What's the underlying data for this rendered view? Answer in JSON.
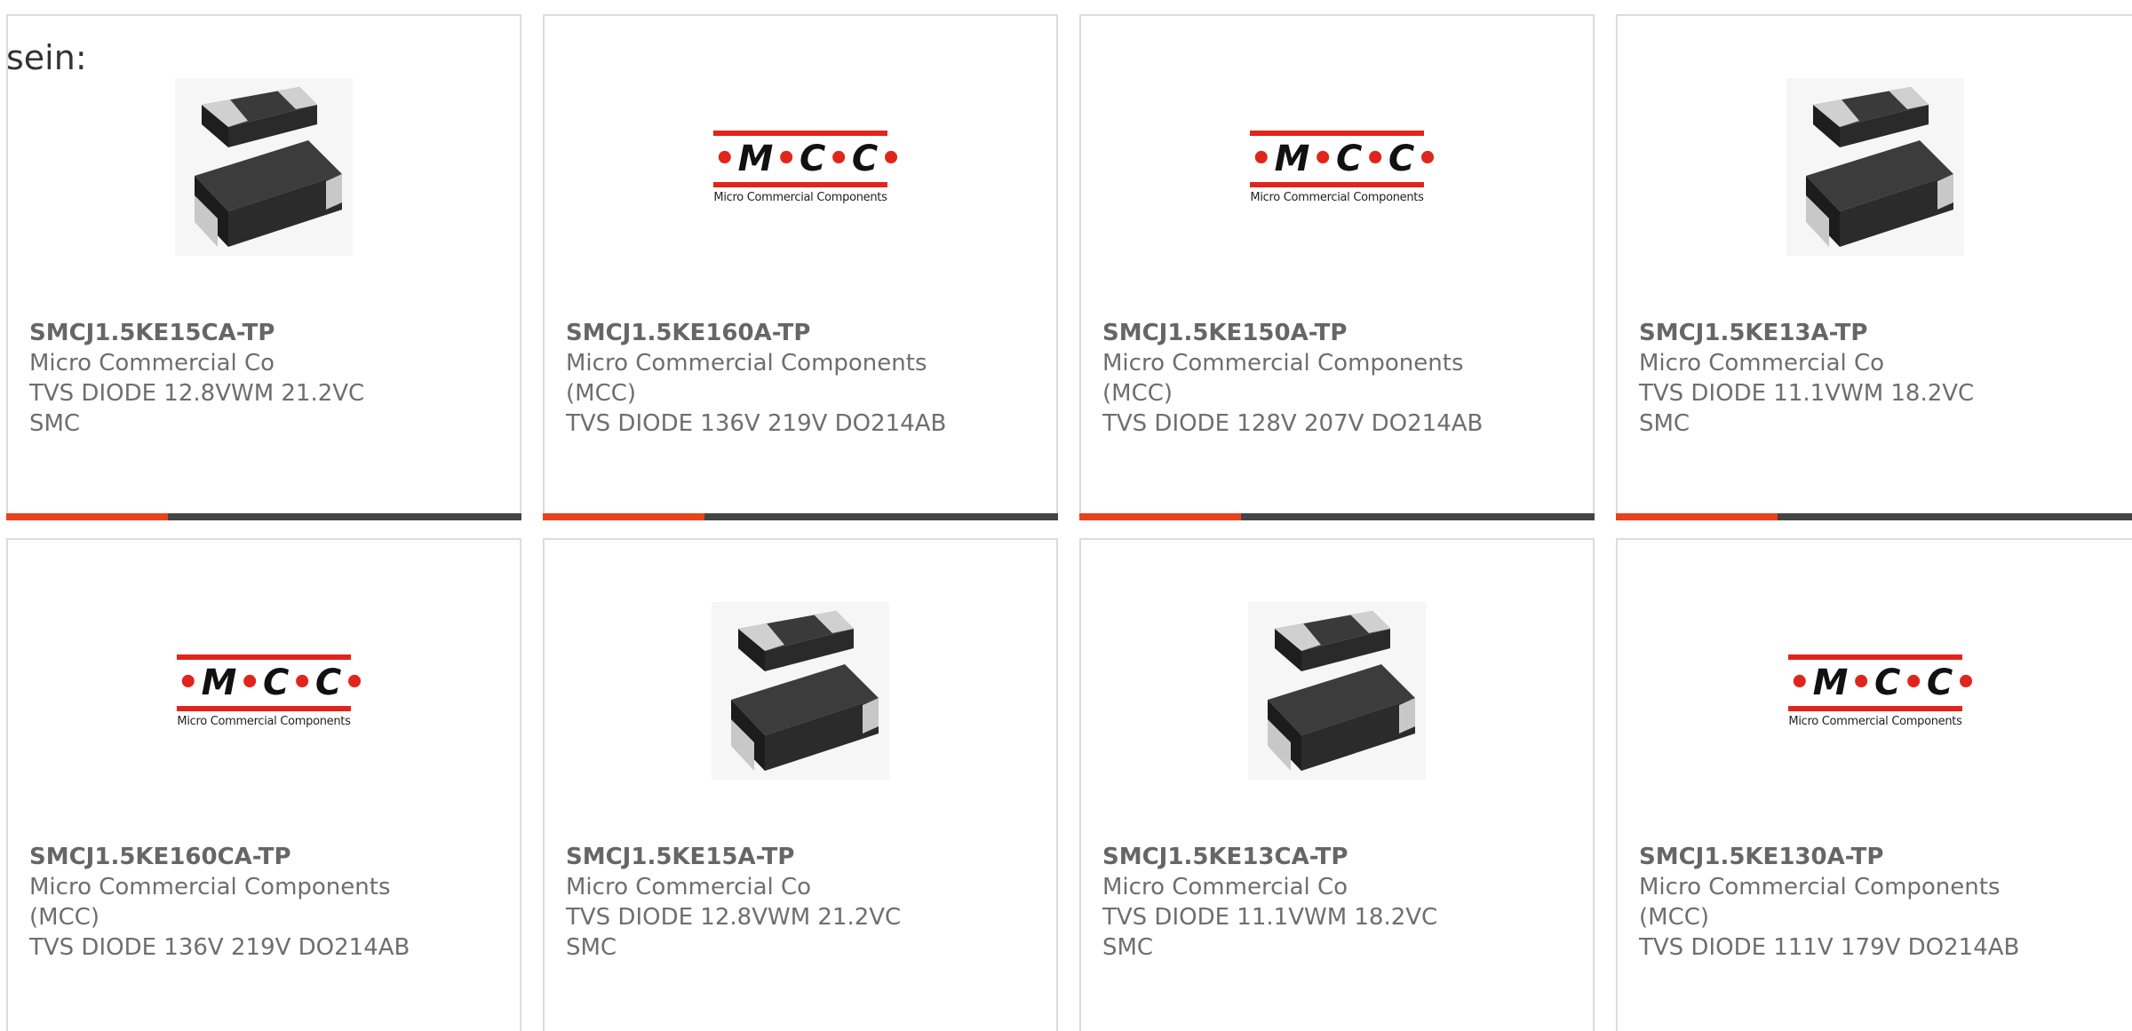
{
  "intro_text": "sein:",
  "colors": {
    "accent_red": "#e8431d",
    "accent_dark": "#444444",
    "mcc_red": "#e0261c"
  },
  "products": [
    {
      "part": "SMCJ1.5KE15CA-TP",
      "manufacturer": "Micro Commercial Co",
      "description": "TVS DIODE 12.8VWM 21.2VC SMC",
      "image": "smc-package"
    },
    {
      "part": "SMCJ1.5KE160A-TP",
      "manufacturer": "Micro Commercial Components (MCC)",
      "description": "TVS DIODE 136V 219V DO214AB",
      "image": "mcc-logo"
    },
    {
      "part": "SMCJ1.5KE150A-TP",
      "manufacturer": "Micro Commercial Components (MCC)",
      "description": "TVS DIODE 128V 207V DO214AB",
      "image": "mcc-logo"
    },
    {
      "part": "SMCJ1.5KE13A-TP",
      "manufacturer": "Micro Commercial Co",
      "description": "TVS DIODE 11.1VWM 18.2VC SMC",
      "image": "smc-package"
    },
    {
      "part": "SMCJ1.5KE160CA-TP",
      "manufacturer": "Micro Commercial Components (MCC)",
      "description": "TVS DIODE 136V 219V DO214AB",
      "image": "mcc-logo"
    },
    {
      "part": "SMCJ1.5KE15A-TP",
      "manufacturer": "Micro Commercial Co",
      "description": "TVS DIODE 12.8VWM 21.2VC SMC",
      "image": "smc-package"
    },
    {
      "part": "SMCJ1.5KE13CA-TP",
      "manufacturer": "Micro Commercial Co",
      "description": "TVS DIODE 11.1VWM 18.2VC SMC",
      "image": "smc-package"
    },
    {
      "part": "SMCJ1.5KE130A-TP",
      "manufacturer": "Micro Commercial Components (MCC)",
      "description": "TVS DIODE 111V 179V DO214AB",
      "image": "mcc-logo"
    }
  ],
  "mcc_logo": {
    "letters": [
      "M",
      "C",
      "C"
    ],
    "tagline": "Micro Commercial Components",
    "trademark": "™"
  }
}
